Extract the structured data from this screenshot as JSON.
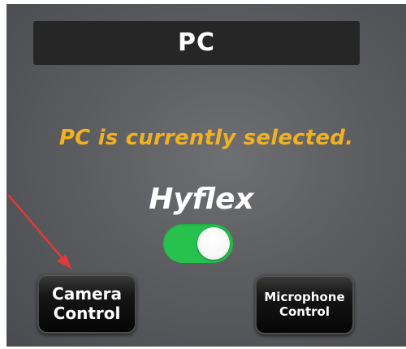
{
  "title_bar": {
    "title": "PC"
  },
  "status": {
    "message": "PC is currently selected."
  },
  "hyflex": {
    "label": "Hyflex",
    "toggle_on": true
  },
  "buttons": {
    "camera": {
      "line1": "Camera",
      "line2": "Control"
    },
    "microphone": {
      "line1": "Microphone",
      "line2": "Control"
    }
  },
  "annotation": {
    "arrow_icon": "red-arrow-icon",
    "arrow_color": "#e03a3a"
  },
  "colors": {
    "status_text": "#f2b120",
    "toggle_on": "#27c24e",
    "title_bar_bg": "#262626"
  }
}
